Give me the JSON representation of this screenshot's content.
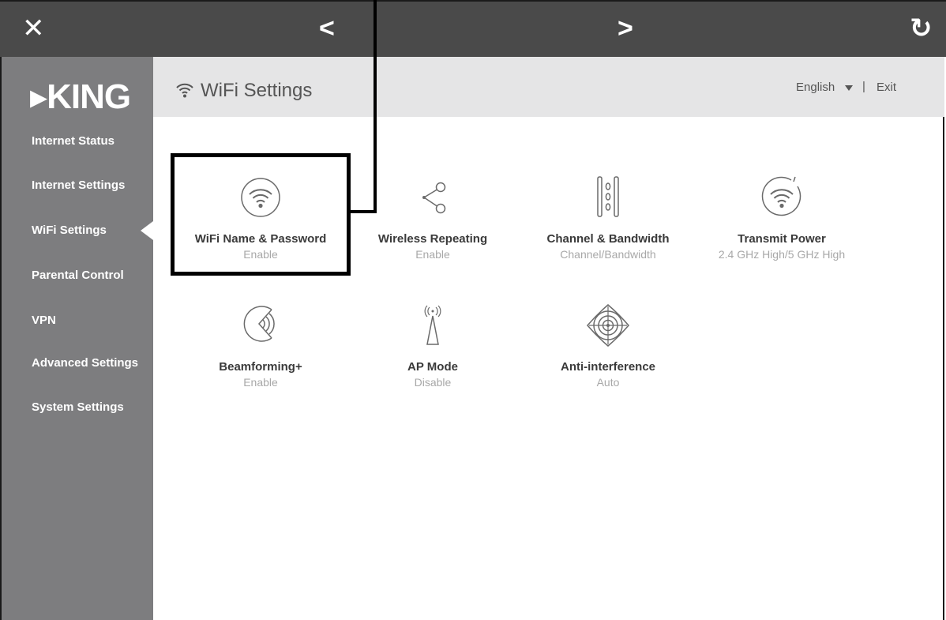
{
  "topbar": {
    "close_glyph": "✕",
    "back_glyph": "<",
    "forward_glyph": ">",
    "refresh_glyph": "↻"
  },
  "sidebar": {
    "logo": "▸KING",
    "active_item": "WiFi Settings",
    "items": [
      {
        "label": "Internet Status"
      },
      {
        "label": "Internet Settings"
      },
      {
        "label": "WiFi Settings"
      },
      {
        "label": "Parental Control"
      },
      {
        "label": "VPN"
      },
      {
        "label": "Advanced Settings"
      },
      {
        "label": "System Settings"
      }
    ]
  },
  "header": {
    "title": "WiFi Settings",
    "title_icon": "wifi-icon",
    "language": "English",
    "separator": "|",
    "exit": "Exit"
  },
  "tiles": [
    {
      "name": "WiFi Name & Password",
      "value": "Enable",
      "icon": "wifi-circle-icon"
    },
    {
      "name": "Wireless Repeating",
      "value": "Enable",
      "icon": "share-nodes-icon"
    },
    {
      "name": "Channel & Bandwidth",
      "value": "Channel/Bandwidth",
      "icon": "channel-bars-icon"
    },
    {
      "name": "Transmit Power",
      "value": "2.4 GHz High/5 GHz High",
      "icon": "wifi-power-icon"
    },
    {
      "name": "Beamforming+",
      "value": "Enable",
      "icon": "beamforming-icon"
    },
    {
      "name": "AP Mode",
      "value": "Disable",
      "icon": "antenna-icon"
    },
    {
      "name": "Anti-interference",
      "value": "Auto",
      "icon": "target-icon"
    }
  ],
  "colors": {
    "topbar": "#4a4a4a",
    "sidebar": "#7d7d7f",
    "header": "#e5e5e6",
    "icon_stroke": "#6a6a6a",
    "highlight": "#000000"
  }
}
